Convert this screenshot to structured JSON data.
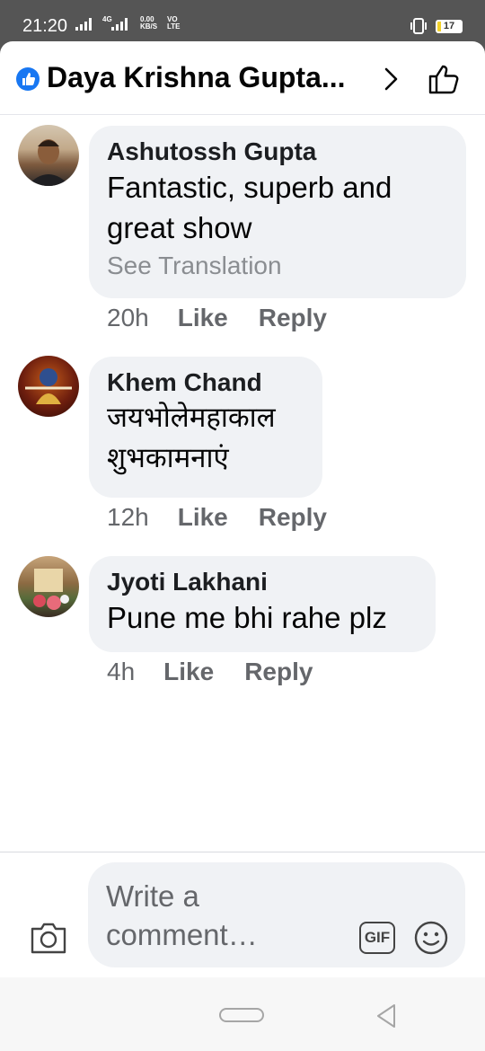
{
  "status_bar": {
    "time": "21:20",
    "net_speed": "0.00",
    "net_speed_unit": "KB/S",
    "net_type_top": "VO",
    "net_type_bottom": "LTE",
    "signal_label": "4G",
    "battery_level": "17",
    "battery_fraction": 0.17
  },
  "header": {
    "title": "Daya Krishna Gupta...",
    "badge_icon": "like-badge-icon",
    "next_icon": "chevron-right-icon",
    "like_icon": "thumbs-up-icon"
  },
  "comments": [
    {
      "author": "Ashutossh Gupta",
      "text": "Fantastic, superb and great show",
      "see_translation": "See Translation",
      "time": "20h",
      "like": "Like",
      "reply": "Reply"
    },
    {
      "author": "Khem Chand",
      "text": "जयभोलेमहाकाल शुभकामनाएं",
      "time": "12h",
      "like": "Like",
      "reply": "Reply"
    },
    {
      "author": "Jyoti Lakhani",
      "text": "Pune me bhi rahe plz",
      "time": "4h",
      "like": "Like",
      "reply": "Reply"
    }
  ],
  "composer": {
    "placeholder": "Write a comment…",
    "gif_label": "GIF",
    "camera_icon": "camera-icon",
    "emoji_icon": "smiley-icon"
  },
  "colors": {
    "brand_blue": "#1877f2",
    "bubble_bg": "#f0f2f5",
    "muted_text": "#65676b",
    "battery_fill": "#f3d22a"
  }
}
